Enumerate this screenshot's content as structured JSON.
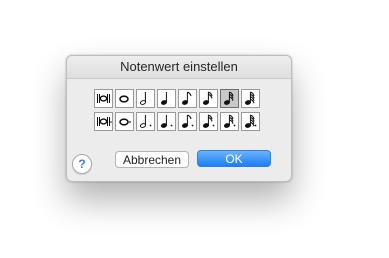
{
  "dialog": {
    "title": "Notenwert einstellen",
    "selected_index": 6
  },
  "note_values": {
    "rows": [
      [
        {
          "name": "breve-note-icon",
          "dotted": false
        },
        {
          "name": "whole-note-icon",
          "dotted": false
        },
        {
          "name": "half-note-icon",
          "dotted": false
        },
        {
          "name": "quarter-note-icon",
          "dotted": false
        },
        {
          "name": "eighth-note-icon",
          "dotted": false
        },
        {
          "name": "sixteenth-note-icon",
          "dotted": false
        },
        {
          "name": "thirty-second-note-icon",
          "dotted": false
        },
        {
          "name": "sixty-fourth-note-icon",
          "dotted": false
        }
      ],
      [
        {
          "name": "dotted-breve-note-icon",
          "dotted": true
        },
        {
          "name": "dotted-whole-note-icon",
          "dotted": true
        },
        {
          "name": "dotted-half-note-icon",
          "dotted": true
        },
        {
          "name": "dotted-quarter-note-icon",
          "dotted": true
        },
        {
          "name": "dotted-eighth-note-icon",
          "dotted": true
        },
        {
          "name": "dotted-sixteenth-note-icon",
          "dotted": true
        },
        {
          "name": "dotted-thirty-second-note-icon",
          "dotted": true
        },
        {
          "name": "dotted-sixty-fourth-note-icon",
          "dotted": true
        }
      ]
    ]
  },
  "buttons": {
    "help_label": "?",
    "cancel_label": "Abbrechen",
    "ok_label": "OK"
  },
  "colors": {
    "accent": "#1b7ef7",
    "selected_cell": "#c9c9c9",
    "help_glyph": "#3b7fd6"
  }
}
